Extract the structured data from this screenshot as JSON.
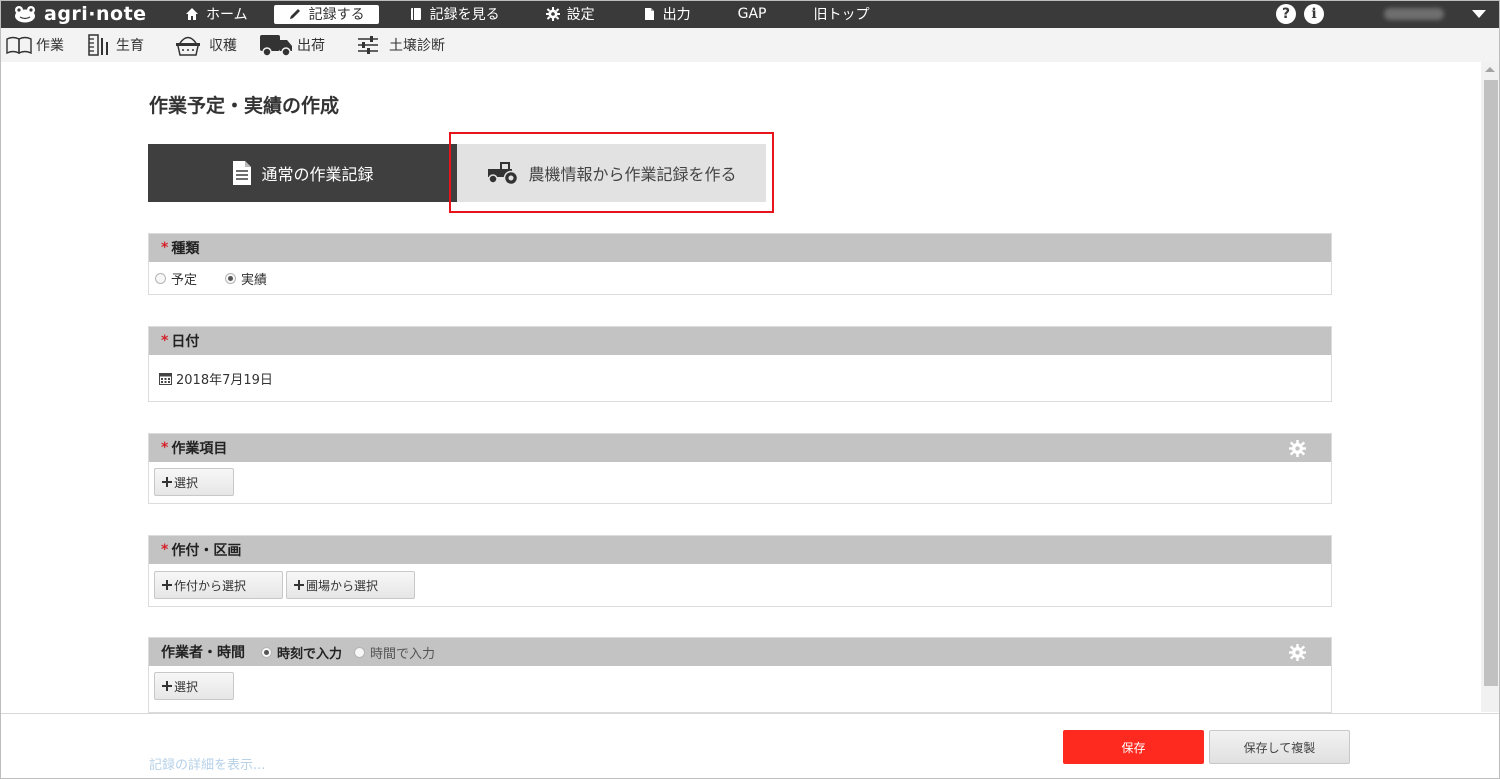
{
  "app": {
    "logo_text": "agri·note"
  },
  "topnav": {
    "items": [
      {
        "label": "ホーム",
        "icon": "home-icon"
      },
      {
        "label": "記録する",
        "icon": "pencil-icon",
        "active": true
      },
      {
        "label": "記録を見る",
        "icon": "book-icon"
      },
      {
        "label": "設定",
        "icon": "gear-icon"
      },
      {
        "label": "出力",
        "icon": "file-icon"
      },
      {
        "label": "GAP"
      },
      {
        "label": "旧トップ"
      }
    ],
    "help_glyph": "?",
    "info_glyph": "i"
  },
  "subnav": {
    "items": [
      {
        "label": "作業",
        "icon": "open-book-icon"
      },
      {
        "label": "生育",
        "icon": "ruler-icon"
      },
      {
        "label": "収穫",
        "icon": "basket-icon"
      },
      {
        "label": "出荷",
        "icon": "truck-icon"
      },
      {
        "label": "土壌診断",
        "icon": "sliders-icon"
      }
    ]
  },
  "page": {
    "title": "作業予定・実績の作成"
  },
  "mode_tabs": {
    "normal_label": "通常の作業記録",
    "machine_label": "農機情報から作業記録を作る"
  },
  "sections": {
    "type": {
      "title": "種類",
      "required_mark": "*",
      "options": [
        "予定",
        "実績"
      ],
      "selected": "実績"
    },
    "date": {
      "title": "日付",
      "required_mark": "*",
      "value": "2018年7月19日"
    },
    "work_item": {
      "title": "作業項目",
      "required_mark": "*",
      "select_label": "選択"
    },
    "crop_field": {
      "title": "作付・区画",
      "required_mark": "*",
      "from_crop_label": "作付から選択",
      "from_field_label": "圃場から選択"
    },
    "worker": {
      "title": "作業者・時間",
      "option_time_of_day": "時刻で入力",
      "option_duration": "時間で入力",
      "selected": "時刻で入力",
      "select_label": "選択"
    }
  },
  "footer": {
    "detail_link": "記録の詳細を表示...",
    "save_label": "保存",
    "save_copy_label": "保存して複製"
  },
  "colors": {
    "topbar": "#3a3a3a",
    "active_tab": "#3f3f3f",
    "save_button": "#ff2a1f",
    "highlight": "#e8141b",
    "section_head": "#c3c3c3"
  }
}
